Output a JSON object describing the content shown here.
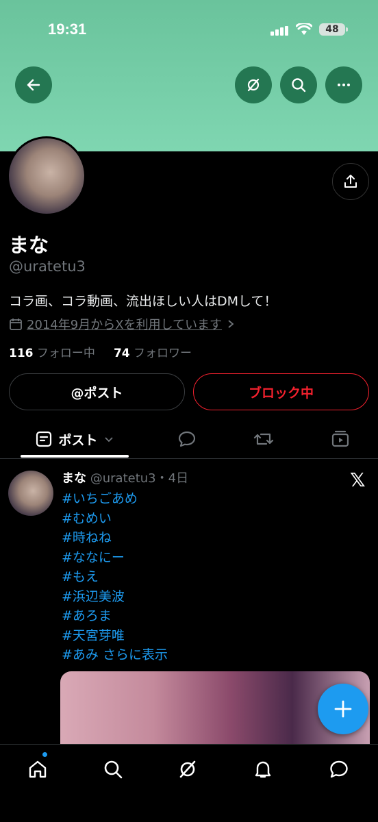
{
  "status": {
    "time": "19:31",
    "battery": "48"
  },
  "profile": {
    "name": "まな",
    "handle": "@uratetu3",
    "bio": "コラ画、コラ動画、流出ほしい人はDMして！",
    "joined": "2014年9月からXを利用しています",
    "following_count": "116",
    "following_label": "フォロー中",
    "followers_count": "74",
    "followers_label": "フォロワー"
  },
  "actions": {
    "post_label": "@ポスト",
    "block_label": "ブロック中"
  },
  "tabs": {
    "posts_label": "ポスト"
  },
  "post": {
    "name": "まな",
    "meta": "@uratetu3・4日",
    "tags": [
      "#いちごあめ",
      "#むめい",
      "#時ねね",
      "#ななにー",
      "#もえ",
      "#浜辺美波",
      "#あろま",
      "#天宮芽唯"
    ],
    "last_tag": "#あみ",
    "more": "さらに表示"
  },
  "colors": {
    "accent": "#1d9bf0",
    "danger": "#f4212e",
    "banner": "#74cfa8"
  }
}
